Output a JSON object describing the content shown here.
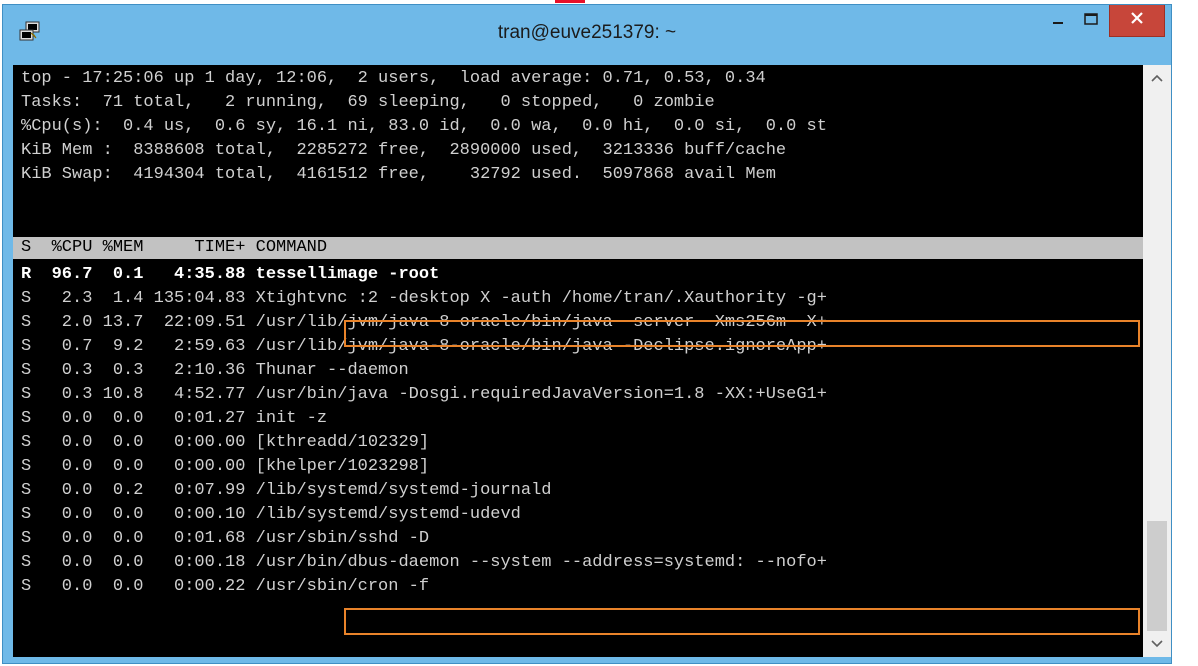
{
  "window": {
    "title": "tran@euve251379: ~",
    "accent_color": "#6fb9e8",
    "close_color": "#c7463a"
  },
  "terminal": {
    "summary": [
      "top - 17:25:06 up 1 day, 12:06,  2 users,  load average: 0.71, 0.53, 0.34",
      "Tasks:  71 total,   2 running,  69 sleeping,   0 stopped,   0 zombie",
      "%Cpu(s):  0.4 us,  0.6 sy, 16.1 ni, 83.0 id,  0.0 wa,  0.0 hi,  0.0 si,  0.0 st",
      "KiB Mem :  8388608 total,  2285272 free,  2890000 used,  3213336 buff/cache",
      "KiB Swap:  4194304 total,  4161512 free,    32792 used.  5097868 avail Mem"
    ],
    "header": "S  %CPU %MEM     TIME+ COMMAND",
    "rows": [
      "R  96.7  0.1   4:35.88 tessellimage -root",
      "S   2.3  1.4 135:04.83 Xtightvnc :2 -desktop X -auth /home/tran/.Xauthority -g+",
      "S   2.0 13.7  22:09.51 /usr/lib/jvm/java-8-oracle/bin/java -server -Xms256m -X+",
      "S   0.7  9.2   2:59.63 /usr/lib/jvm/java-8-oracle/bin/java -Declipse.ignoreApp+",
      "S   0.3  0.3   2:10.36 Thunar --daemon",
      "S   0.3 10.8   4:52.77 /usr/bin/java -Dosgi.requiredJavaVersion=1.8 -XX:+UseG1+",
      "S   0.0  0.0   0:01.27 init -z",
      "S   0.0  0.0   0:00.00 [kthreadd/102329]",
      "S   0.0  0.0   0:00.00 [khelper/1023298]",
      "S   0.0  0.2   0:07.99 /lib/systemd/systemd-journald",
      "S   0.0  0.0   0:00.10 /lib/systemd/systemd-udevd",
      "S   0.0  0.0   0:01.68 /usr/sbin/sshd -D",
      "S   0.0  0.0   0:00.18 /usr/bin/dbus-daemon --system --address=systemd: --nofo+",
      "S   0.0  0.0   0:00.22 /usr/sbin/cron -f"
    ]
  },
  "icons": {
    "app": "putty-icon",
    "minimize": "minimize-icon",
    "maximize": "maximize-icon",
    "close": "close-icon",
    "scroll_up": "chevron-up-icon",
    "scroll_down": "chevron-down-icon"
  }
}
